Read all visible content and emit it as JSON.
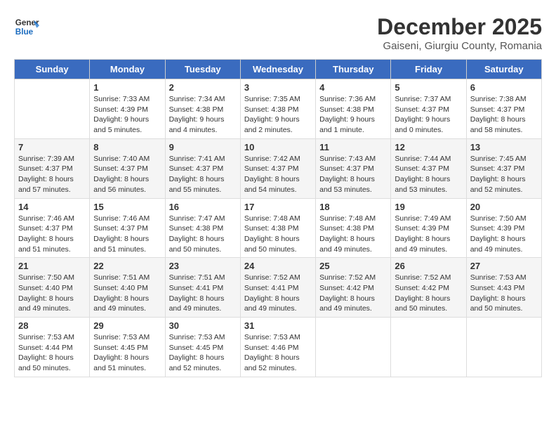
{
  "logo": {
    "line1": "General",
    "line2": "Blue"
  },
  "title": "December 2025",
  "subtitle": "Gaiseni, Giurgiu County, Romania",
  "days_of_week": [
    "Sunday",
    "Monday",
    "Tuesday",
    "Wednesday",
    "Thursday",
    "Friday",
    "Saturday"
  ],
  "weeks": [
    [
      {
        "day": "",
        "info": ""
      },
      {
        "day": "1",
        "info": "Sunrise: 7:33 AM\nSunset: 4:39 PM\nDaylight: 9 hours\nand 5 minutes."
      },
      {
        "day": "2",
        "info": "Sunrise: 7:34 AM\nSunset: 4:38 PM\nDaylight: 9 hours\nand 4 minutes."
      },
      {
        "day": "3",
        "info": "Sunrise: 7:35 AM\nSunset: 4:38 PM\nDaylight: 9 hours\nand 2 minutes."
      },
      {
        "day": "4",
        "info": "Sunrise: 7:36 AM\nSunset: 4:38 PM\nDaylight: 9 hours\nand 1 minute."
      },
      {
        "day": "5",
        "info": "Sunrise: 7:37 AM\nSunset: 4:37 PM\nDaylight: 9 hours\nand 0 minutes."
      },
      {
        "day": "6",
        "info": "Sunrise: 7:38 AM\nSunset: 4:37 PM\nDaylight: 8 hours\nand 58 minutes."
      }
    ],
    [
      {
        "day": "7",
        "info": "Sunrise: 7:39 AM\nSunset: 4:37 PM\nDaylight: 8 hours\nand 57 minutes."
      },
      {
        "day": "8",
        "info": "Sunrise: 7:40 AM\nSunset: 4:37 PM\nDaylight: 8 hours\nand 56 minutes."
      },
      {
        "day": "9",
        "info": "Sunrise: 7:41 AM\nSunset: 4:37 PM\nDaylight: 8 hours\nand 55 minutes."
      },
      {
        "day": "10",
        "info": "Sunrise: 7:42 AM\nSunset: 4:37 PM\nDaylight: 8 hours\nand 54 minutes."
      },
      {
        "day": "11",
        "info": "Sunrise: 7:43 AM\nSunset: 4:37 PM\nDaylight: 8 hours\nand 53 minutes."
      },
      {
        "day": "12",
        "info": "Sunrise: 7:44 AM\nSunset: 4:37 PM\nDaylight: 8 hours\nand 53 minutes."
      },
      {
        "day": "13",
        "info": "Sunrise: 7:45 AM\nSunset: 4:37 PM\nDaylight: 8 hours\nand 52 minutes."
      }
    ],
    [
      {
        "day": "14",
        "info": "Sunrise: 7:46 AM\nSunset: 4:37 PM\nDaylight: 8 hours\nand 51 minutes."
      },
      {
        "day": "15",
        "info": "Sunrise: 7:46 AM\nSunset: 4:37 PM\nDaylight: 8 hours\nand 51 minutes."
      },
      {
        "day": "16",
        "info": "Sunrise: 7:47 AM\nSunset: 4:38 PM\nDaylight: 8 hours\nand 50 minutes."
      },
      {
        "day": "17",
        "info": "Sunrise: 7:48 AM\nSunset: 4:38 PM\nDaylight: 8 hours\nand 50 minutes."
      },
      {
        "day": "18",
        "info": "Sunrise: 7:48 AM\nSunset: 4:38 PM\nDaylight: 8 hours\nand 49 minutes."
      },
      {
        "day": "19",
        "info": "Sunrise: 7:49 AM\nSunset: 4:39 PM\nDaylight: 8 hours\nand 49 minutes."
      },
      {
        "day": "20",
        "info": "Sunrise: 7:50 AM\nSunset: 4:39 PM\nDaylight: 8 hours\nand 49 minutes."
      }
    ],
    [
      {
        "day": "21",
        "info": "Sunrise: 7:50 AM\nSunset: 4:40 PM\nDaylight: 8 hours\nand 49 minutes."
      },
      {
        "day": "22",
        "info": "Sunrise: 7:51 AM\nSunset: 4:40 PM\nDaylight: 8 hours\nand 49 minutes."
      },
      {
        "day": "23",
        "info": "Sunrise: 7:51 AM\nSunset: 4:41 PM\nDaylight: 8 hours\nand 49 minutes."
      },
      {
        "day": "24",
        "info": "Sunrise: 7:52 AM\nSunset: 4:41 PM\nDaylight: 8 hours\nand 49 minutes."
      },
      {
        "day": "25",
        "info": "Sunrise: 7:52 AM\nSunset: 4:42 PM\nDaylight: 8 hours\nand 49 minutes."
      },
      {
        "day": "26",
        "info": "Sunrise: 7:52 AM\nSunset: 4:42 PM\nDaylight: 8 hours\nand 50 minutes."
      },
      {
        "day": "27",
        "info": "Sunrise: 7:53 AM\nSunset: 4:43 PM\nDaylight: 8 hours\nand 50 minutes."
      }
    ],
    [
      {
        "day": "28",
        "info": "Sunrise: 7:53 AM\nSunset: 4:44 PM\nDaylight: 8 hours\nand 50 minutes."
      },
      {
        "day": "29",
        "info": "Sunrise: 7:53 AM\nSunset: 4:45 PM\nDaylight: 8 hours\nand 51 minutes."
      },
      {
        "day": "30",
        "info": "Sunrise: 7:53 AM\nSunset: 4:45 PM\nDaylight: 8 hours\nand 52 minutes."
      },
      {
        "day": "31",
        "info": "Sunrise: 7:53 AM\nSunset: 4:46 PM\nDaylight: 8 hours\nand 52 minutes."
      },
      {
        "day": "",
        "info": ""
      },
      {
        "day": "",
        "info": ""
      },
      {
        "day": "",
        "info": ""
      }
    ]
  ]
}
